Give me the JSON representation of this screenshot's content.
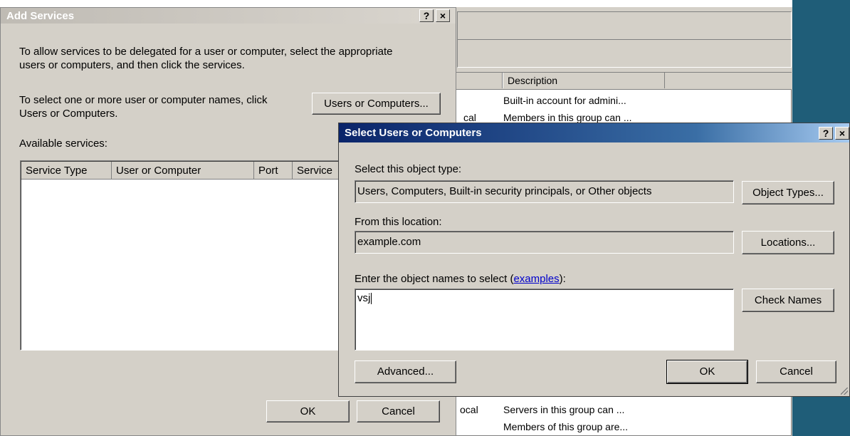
{
  "background_window": {
    "columns": [
      "",
      "Description"
    ],
    "rows": [
      {
        "type": "",
        "description": "Built-in account for admini..."
      },
      {
        "type": "cal",
        "description": "Members in this group can ..."
      },
      {
        "type": "ocal",
        "description": "Servers in this group can ..."
      },
      {
        "type": "",
        "description": "Members of this group are..."
      }
    ]
  },
  "add_services": {
    "title": "Add Services",
    "help_btn": "?",
    "close_btn": "×",
    "instructions_line1": "To allow services to be delegated for a user or computer, select the appropriate",
    "instructions_line2": "users or computers, and then click the services.",
    "select_line1": "To select one or more user or computer names, click",
    "select_line2": "Users or Computers.",
    "users_or_computers_btn": "Users or Computers...",
    "available_services_label": "Available services:",
    "columns": [
      "Service Type",
      "User or Computer",
      "Port",
      "Service"
    ],
    "ok": "OK",
    "cancel": "Cancel"
  },
  "select_users": {
    "title": "Select Users or Computers",
    "help_btn": "?",
    "close_btn": "×",
    "object_type_label": "Select this object type:",
    "object_type_value": "Users, Computers, Built-in security principals, or Other objects",
    "object_types_btn": "Object Types...",
    "location_label": "From this location:",
    "location_value": "example.com",
    "locations_btn": "Locations...",
    "names_label_prefix": "Enter the object names to select (",
    "names_label_link": "examples",
    "names_label_suffix": "):",
    "names_value": "vsj",
    "check_names_btn": "Check Names",
    "advanced_btn": "Advanced...",
    "ok": "OK",
    "cancel": "Cancel"
  }
}
